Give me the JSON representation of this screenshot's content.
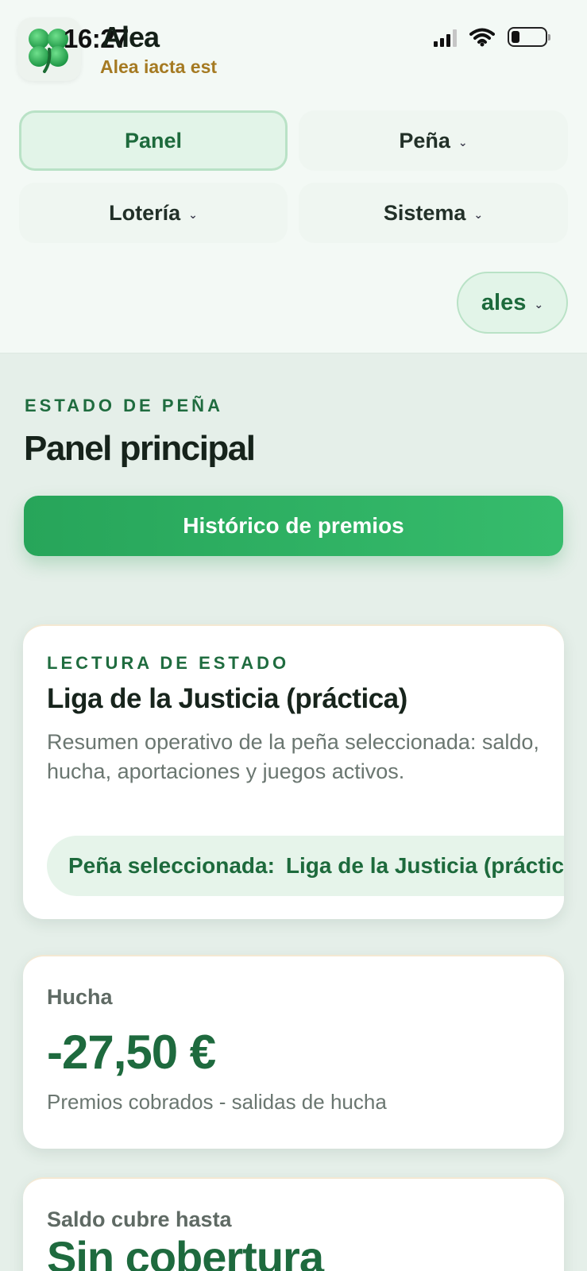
{
  "status_bar": {
    "time": "16:27"
  },
  "brand": {
    "name": "Alea",
    "tagline": "Alea iacta est",
    "logo_icon": "four-leaf-clover-icon",
    "accent_color": "#a57a22"
  },
  "nav": {
    "panel": "Panel",
    "pena": "Peña",
    "loteria": "Lotería",
    "sistema": "Sistema",
    "user": "ales",
    "active_color": "#1d6a3c"
  },
  "page": {
    "eyebrow": "ESTADO DE PEÑA",
    "title": "Panel principal",
    "primary_button": "Histórico de premios"
  },
  "status_card": {
    "eyebrow": "LECTURA DE ESTADO",
    "title": "Liga de la Justicia (práctica)",
    "description": "Resumen operativo de la peña seleccionada: saldo, hucha, aportaciones y juegos activos.",
    "selected_label": "Peña seleccionada:",
    "selected_value": "Liga de la Justicia (práctica)"
  },
  "hucha_card": {
    "label": "Hucha",
    "value": "-27,50 €",
    "caption": "Premios cobrados - salidas de hucha"
  },
  "saldo_card": {
    "label": "Saldo cubre hasta",
    "value": "Sin cobertura"
  }
}
